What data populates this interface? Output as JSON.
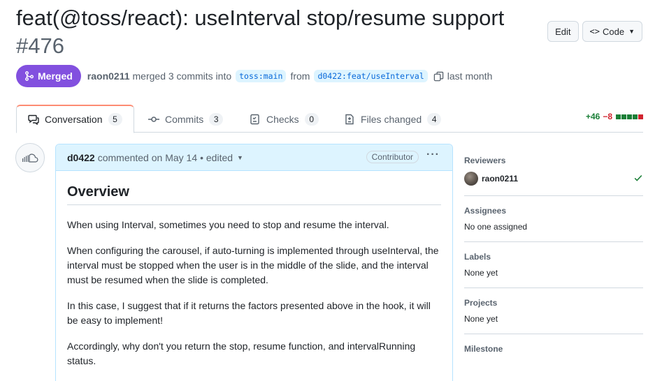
{
  "pr": {
    "title": "feat(@toss/react): useInterval stop/resume support",
    "number": "#476",
    "state": "Merged",
    "merger": "raon0211",
    "merged_text": "merged 3 commits into",
    "base_branch": "toss:main",
    "from_text": "from",
    "head_branch": "d0422:feat/useInterval",
    "time": "last month"
  },
  "header_actions": {
    "edit": "Edit",
    "code": "Code"
  },
  "tabs": [
    {
      "label": "Conversation",
      "count": "5"
    },
    {
      "label": "Commits",
      "count": "3"
    },
    {
      "label": "Checks",
      "count": "0"
    },
    {
      "label": "Files changed",
      "count": "4"
    }
  ],
  "diffstat": {
    "additions": "+46",
    "deletions": "−8"
  },
  "comment": {
    "author": "d0422",
    "meta": "commented on May 14",
    "edited": "• edited",
    "role": "Contributor",
    "heading": "Overview",
    "paragraphs": [
      "When using Interval, sometimes you need to stop and resume the interval.",
      "When configuring the carousel, if auto-turning is implemented through useInterval, the interval must be stopped when the user is in the middle of the slide, and the interval must be resumed when the slide is completed.",
      "In this case, I suggest that if it returns the factors presented above in the hook, it will be easy to implement!",
      "Accordingly, why don't you return the stop, resume function, and intervalRunning status."
    ]
  },
  "sidebar": {
    "reviewers_title": "Reviewers",
    "reviewer": "raon0211",
    "assignees_title": "Assignees",
    "assignees_value": "No one assigned",
    "labels_title": "Labels",
    "labels_value": "None yet",
    "projects_title": "Projects",
    "projects_value": "None yet",
    "milestone_title": "Milestone"
  },
  "colors": {
    "merged": "#8250df",
    "accent_tab": "#fd8c73",
    "addition": "#1a7f37",
    "deletion": "#d1242f"
  }
}
